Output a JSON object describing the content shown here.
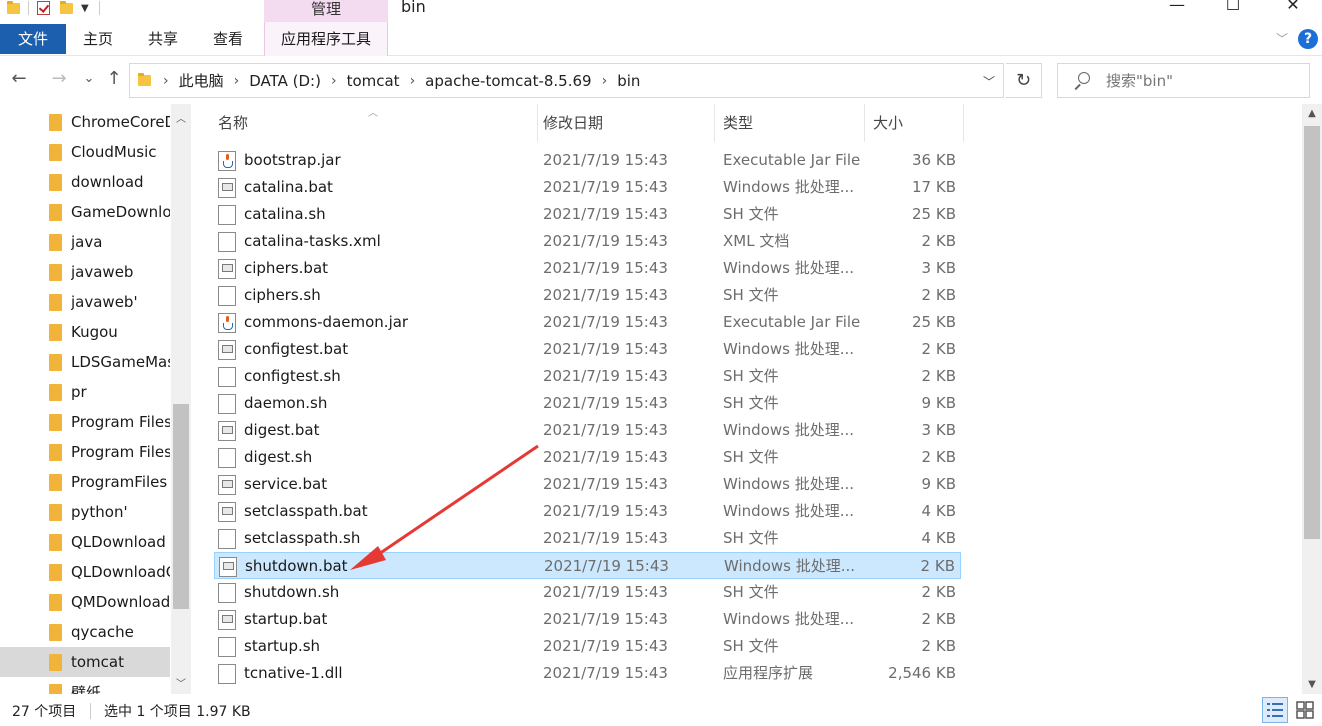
{
  "window": {
    "title": "bin",
    "context_tab_header": "管理",
    "controls": {
      "minimize": "—",
      "maximize": "☐",
      "close": "✕"
    }
  },
  "ribbon": {
    "file_tab": "文件",
    "tabs": [
      "主页",
      "共享",
      "查看"
    ],
    "context_tab": "应用程序工具",
    "help": "?"
  },
  "navigation": {
    "back": "←",
    "forward": "→",
    "recent": "⌄",
    "up": "↑",
    "breadcrumb": [
      "此电脑",
      "DATA (D:)",
      "tomcat",
      "apache-tomcat-8.5.69",
      "bin"
    ],
    "refresh": "↻",
    "search_placeholder": "搜索\"bin\""
  },
  "nav_pane": {
    "items": [
      {
        "label": "ChromeCoreD",
        "selected": false
      },
      {
        "label": "CloudMusic",
        "selected": false
      },
      {
        "label": "download",
        "selected": false
      },
      {
        "label": "GameDownlo",
        "selected": false
      },
      {
        "label": "java",
        "selected": false
      },
      {
        "label": "javaweb",
        "selected": false
      },
      {
        "label": "javaweb'",
        "selected": false
      },
      {
        "label": "Kugou",
        "selected": false
      },
      {
        "label": "LDSGameMas",
        "selected": false
      },
      {
        "label": "pr",
        "selected": false
      },
      {
        "label": "Program Files",
        "selected": false
      },
      {
        "label": "Program Files",
        "selected": false
      },
      {
        "label": "ProgramFiles",
        "selected": false
      },
      {
        "label": "python'",
        "selected": false
      },
      {
        "label": "QLDownload",
        "selected": false
      },
      {
        "label": "QLDownloadG",
        "selected": false
      },
      {
        "label": "QMDownload",
        "selected": false
      },
      {
        "label": "qycache",
        "selected": false
      },
      {
        "label": "tomcat",
        "selected": true
      },
      {
        "label": "壁纸",
        "selected": false
      }
    ]
  },
  "file_list": {
    "columns": {
      "name": "名称",
      "modified": "修改日期",
      "type": "类型",
      "size": "大小"
    },
    "files": [
      {
        "name": "bootstrap.jar",
        "modified": "2021/7/19 15:43",
        "type": "Executable Jar File",
        "size": "36 KB",
        "icon": "jar-icon",
        "selected": false
      },
      {
        "name": "catalina.bat",
        "modified": "2021/7/19 15:43",
        "type": "Windows 批处理...",
        "size": "17 KB",
        "icon": "bat-icon",
        "selected": false
      },
      {
        "name": "catalina.sh",
        "modified": "2021/7/19 15:43",
        "type": "SH 文件",
        "size": "25 KB",
        "icon": "file-icon",
        "selected": false
      },
      {
        "name": "catalina-tasks.xml",
        "modified": "2021/7/19 15:43",
        "type": "XML 文档",
        "size": "2 KB",
        "icon": "file-icon",
        "selected": false
      },
      {
        "name": "ciphers.bat",
        "modified": "2021/7/19 15:43",
        "type": "Windows 批处理...",
        "size": "3 KB",
        "icon": "bat-icon",
        "selected": false
      },
      {
        "name": "ciphers.sh",
        "modified": "2021/7/19 15:43",
        "type": "SH 文件",
        "size": "2 KB",
        "icon": "file-icon",
        "selected": false
      },
      {
        "name": "commons-daemon.jar",
        "modified": "2021/7/19 15:43",
        "type": "Executable Jar File",
        "size": "25 KB",
        "icon": "jar-icon",
        "selected": false
      },
      {
        "name": "configtest.bat",
        "modified": "2021/7/19 15:43",
        "type": "Windows 批处理...",
        "size": "2 KB",
        "icon": "bat-icon",
        "selected": false
      },
      {
        "name": "configtest.sh",
        "modified": "2021/7/19 15:43",
        "type": "SH 文件",
        "size": "2 KB",
        "icon": "file-icon",
        "selected": false
      },
      {
        "name": "daemon.sh",
        "modified": "2021/7/19 15:43",
        "type": "SH 文件",
        "size": "9 KB",
        "icon": "file-icon",
        "selected": false
      },
      {
        "name": "digest.bat",
        "modified": "2021/7/19 15:43",
        "type": "Windows 批处理...",
        "size": "3 KB",
        "icon": "bat-icon",
        "selected": false
      },
      {
        "name": "digest.sh",
        "modified": "2021/7/19 15:43",
        "type": "SH 文件",
        "size": "2 KB",
        "icon": "file-icon",
        "selected": false
      },
      {
        "name": "service.bat",
        "modified": "2021/7/19 15:43",
        "type": "Windows 批处理...",
        "size": "9 KB",
        "icon": "bat-icon",
        "selected": false
      },
      {
        "name": "setclasspath.bat",
        "modified": "2021/7/19 15:43",
        "type": "Windows 批处理...",
        "size": "4 KB",
        "icon": "bat-icon",
        "selected": false
      },
      {
        "name": "setclasspath.sh",
        "modified": "2021/7/19 15:43",
        "type": "SH 文件",
        "size": "4 KB",
        "icon": "file-icon",
        "selected": false
      },
      {
        "name": "shutdown.bat",
        "modified": "2021/7/19 15:43",
        "type": "Windows 批处理...",
        "size": "2 KB",
        "icon": "bat-icon",
        "selected": true
      },
      {
        "name": "shutdown.sh",
        "modified": "2021/7/19 15:43",
        "type": "SH 文件",
        "size": "2 KB",
        "icon": "file-icon",
        "selected": false
      },
      {
        "name": "startup.bat",
        "modified": "2021/7/19 15:43",
        "type": "Windows 批处理...",
        "size": "2 KB",
        "icon": "bat-icon",
        "selected": false
      },
      {
        "name": "startup.sh",
        "modified": "2021/7/19 15:43",
        "type": "SH 文件",
        "size": "2 KB",
        "icon": "file-icon",
        "selected": false
      },
      {
        "name": "tcnative-1.dll",
        "modified": "2021/7/19 15:43",
        "type": "应用程序扩展",
        "size": "2,546 KB",
        "icon": "file-icon",
        "selected": false
      }
    ]
  },
  "status": {
    "item_count": "27 个项目",
    "selection": "选中 1 个项目  1.97 KB"
  },
  "annotation": {
    "color": "#e53935",
    "points_to": "shutdown.bat"
  },
  "colors": {
    "accent": "#1c5fae",
    "selection": "#cce8ff",
    "context_tab": "#f4dcf0"
  }
}
